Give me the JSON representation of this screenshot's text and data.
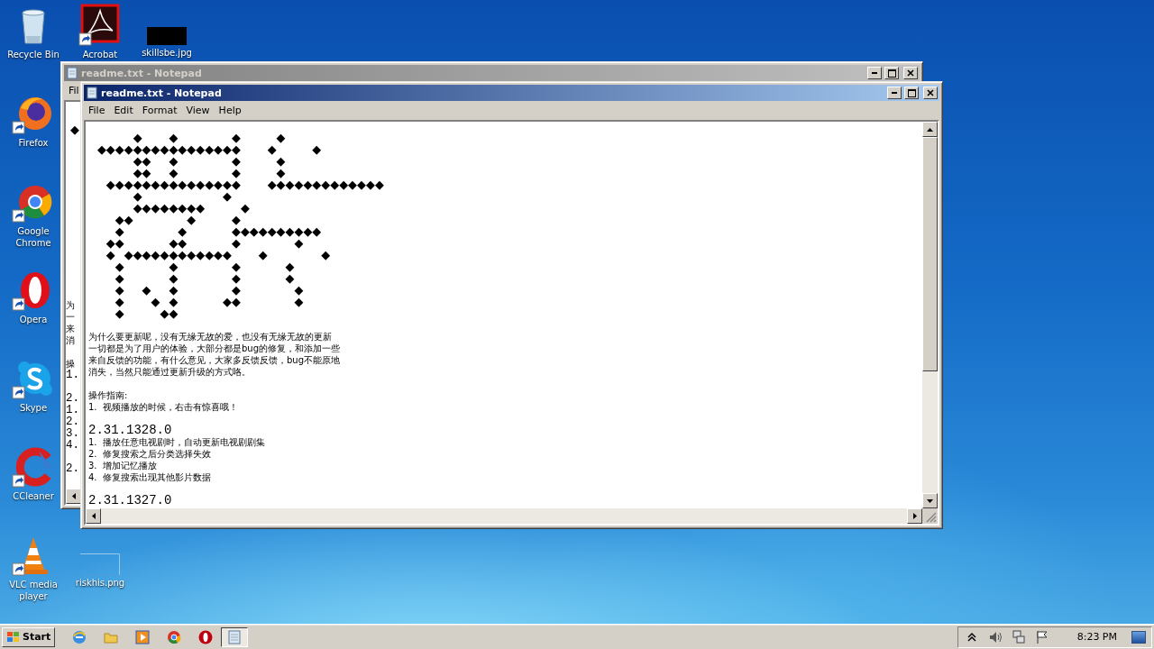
{
  "desktop": {
    "icons": [
      {
        "label": "Recycle Bin",
        "kind": "bin",
        "shortcut": false
      },
      {
        "label": "Acrobat",
        "kind": "swirl",
        "shortcut": true
      },
      {
        "label": "skillsbe.jpg",
        "kind": "dark",
        "shortcut": false
      },
      {
        "label": "Firefox",
        "kind": "globe",
        "shortcut": true
      },
      {
        "label": "Google Chrome",
        "kind": "wheel",
        "shortcut": true
      },
      {
        "label": "Opera",
        "kind": "ring",
        "shortcut": true
      },
      {
        "label": "Skype",
        "kind": "cloud",
        "shortcut": true
      },
      {
        "label": "CCleaner",
        "kind": "arc",
        "shortcut": true
      },
      {
        "label": "VLC media player",
        "kind": "cone",
        "shortcut": true
      },
      {
        "label": "riskhis.png",
        "kind": "blank",
        "shortcut": false
      }
    ]
  },
  "back_window": {
    "title": "readme.txt - Notepad",
    "active": false,
    "menu": [
      "Fil"
    ],
    "lines": [
      {
        "kind": "gap"
      },
      {
        "kind": "art",
        "text": "◆"
      },
      {
        "kind": "gap"
      },
      {
        "kind": "gap"
      },
      {
        "kind": "gap"
      },
      {
        "kind": "gap"
      },
      {
        "kind": "gap"
      },
      {
        "kind": "gap"
      },
      {
        "kind": "gap"
      },
      {
        "kind": "gap"
      },
      {
        "kind": "gap"
      },
      {
        "kind": "gap"
      },
      {
        "kind": "gap"
      },
      {
        "kind": "gap"
      },
      {
        "kind": "gap"
      },
      {
        "kind": "gap"
      },
      {
        "kind": "para",
        "text": "为"
      },
      {
        "kind": "para",
        "text": "一"
      },
      {
        "kind": "para",
        "text": "来"
      },
      {
        "kind": "para",
        "text": "消"
      },
      {
        "kind": "gap"
      },
      {
        "kind": "para",
        "text": "操"
      },
      {
        "kind": "version",
        "text": "1."
      },
      {
        "kind": "gap"
      },
      {
        "kind": "version",
        "text": "2."
      },
      {
        "kind": "version",
        "text": "1."
      },
      {
        "kind": "version",
        "text": "2."
      },
      {
        "kind": "version",
        "text": "3."
      },
      {
        "kind": "version",
        "text": "4."
      },
      {
        "kind": "gap"
      },
      {
        "kind": "version",
        "text": "2."
      }
    ]
  },
  "front_window": {
    "title": "readme.txt - Notepad",
    "active": true,
    "menu": [
      "File",
      "Edit",
      "Format",
      "View",
      "Help"
    ],
    "lines": [
      {
        "kind": "art",
        "text": "     ◆   ◆      ◆    ◆"
      },
      {
        "kind": "art",
        "text": " ◆◆◆◆◆◆◆◆◆◆◆◆◆◆◆◆   ◆    ◆"
      },
      {
        "kind": "art",
        "text": "     ◆◆  ◆      ◆    ◆"
      },
      {
        "kind": "art",
        "text": "     ◆◆  ◆      ◆    ◆"
      },
      {
        "kind": "art",
        "text": "  ◆◆◆◆◆◆◆◆◆◆◆◆◆◆◆   ◆◆◆◆◆◆◆◆◆◆◆◆◆"
      },
      {
        "kind": "art",
        "text": "     ◆         ◆"
      },
      {
        "kind": "art",
        "text": "     ◆◆◆◆◆◆◆◆    ◆"
      },
      {
        "kind": "art",
        "text": "   ◆◆      ◆    ◆"
      },
      {
        "kind": "art",
        "text": "   ◆      ◆     ◆◆◆◆◆◆◆◆◆◆"
      },
      {
        "kind": "art",
        "text": "  ◆◆     ◆◆     ◆      ◆"
      },
      {
        "kind": "art",
        "text": "  ◆ ◆◆◆◆◆◆◆◆◆◆◆◆   ◆      ◆"
      },
      {
        "kind": "art",
        "text": "   ◆     ◆      ◆     ◆"
      },
      {
        "kind": "art",
        "text": "   ◆     ◆      ◆     ◆"
      },
      {
        "kind": "art",
        "text": "   ◆  ◆  ◆      ◆      ◆"
      },
      {
        "kind": "art",
        "text": "   ◆   ◆ ◆     ◆◆      ◆"
      },
      {
        "kind": "art",
        "text": "   ◆    ◆◆"
      },
      {
        "kind": "gap"
      },
      {
        "kind": "para",
        "text": "为什么要更新呢，没有无缘无故的爱，也没有无缘无故的更新"
      },
      {
        "kind": "para",
        "text": "一切都是为了用户的体验，大部分都是bug的修复，和添加一些"
      },
      {
        "kind": "para",
        "text": "来自反馈的功能，有什么意见，大家多反馈反馈，bug不能原地"
      },
      {
        "kind": "para",
        "text": "消失，当然只能通过更新升级的方式咯。"
      },
      {
        "kind": "gap"
      },
      {
        "kind": "para",
        "text": "操作指南:"
      },
      {
        "kind": "para",
        "text": "1.  视频播放的时候，右击有惊喜哦！"
      },
      {
        "kind": "gap"
      },
      {
        "kind": "version",
        "text": "2.31.1328.0"
      },
      {
        "kind": "para",
        "text": "1.  播放任意电视剧时，自动更新电视剧剧集"
      },
      {
        "kind": "para",
        "text": "2.  修复搜索之后分类选择失效"
      },
      {
        "kind": "para",
        "text": "3.  增加记忆播放"
      },
      {
        "kind": "para",
        "text": "4.  修复搜索出现其他影片数据"
      },
      {
        "kind": "gap"
      },
      {
        "kind": "version",
        "text": "2.31.1327.0"
      }
    ]
  },
  "taskbar": {
    "start": "Start",
    "quick_launch": [
      {
        "kind": "globe"
      },
      {
        "kind": "folder"
      },
      {
        "kind": "player"
      },
      {
        "kind": "wheel"
      },
      {
        "kind": "ring"
      }
    ],
    "tasks": [
      {
        "kind": "notepad",
        "selected": true
      }
    ],
    "tray": [
      {
        "kind": "chevron"
      },
      {
        "kind": "speaker"
      },
      {
        "kind": "network"
      },
      {
        "kind": "flag"
      }
    ],
    "clock": "8:23 PM"
  }
}
